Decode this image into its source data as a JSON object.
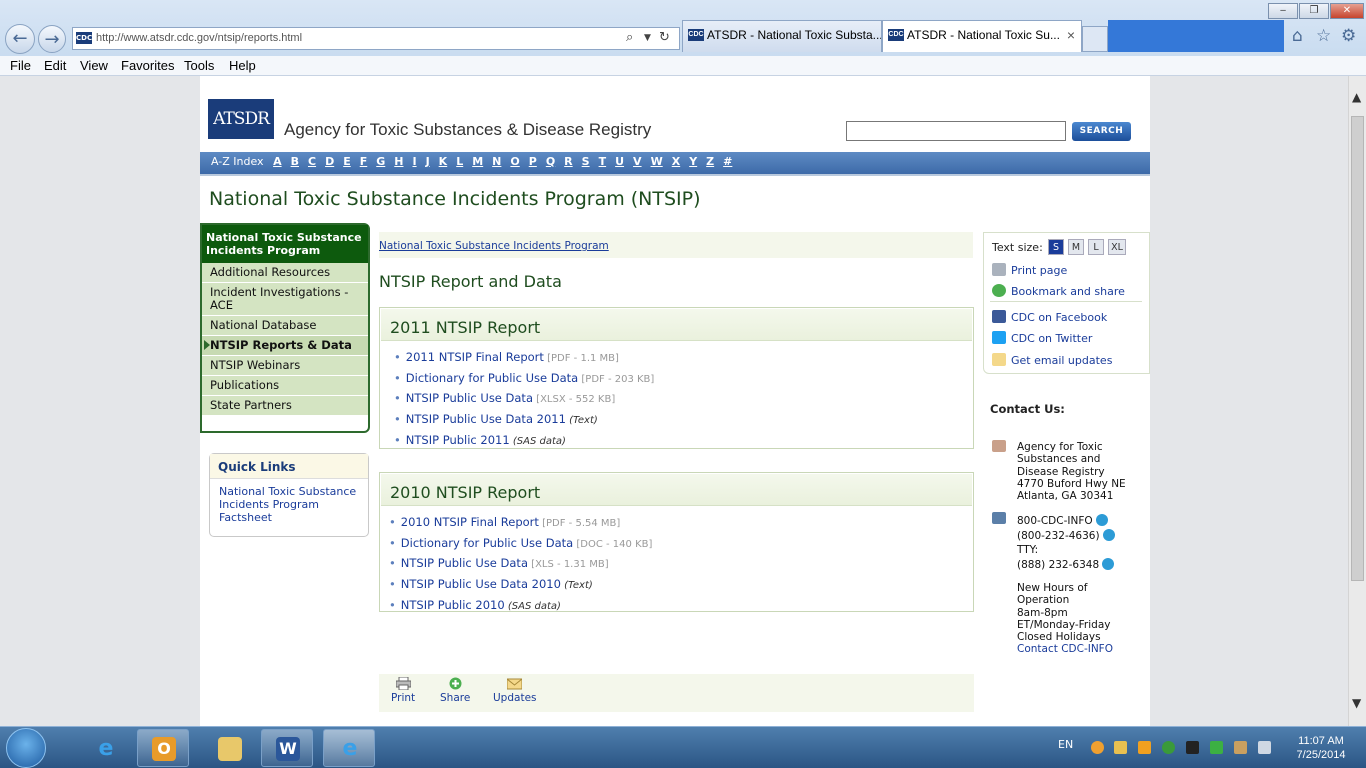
{
  "browser": {
    "url": "http://www.atsdr.cdc.gov/ntsip/reports.html",
    "favicon": "CDC",
    "tabs": [
      {
        "label": "ATSDR - National Toxic Substa...",
        "active": false
      },
      {
        "label": "ATSDR - National Toxic Su...",
        "active": true
      }
    ],
    "tab_close": "×",
    "menu": [
      "File",
      "Edit",
      "View",
      "Favorites",
      "Tools",
      "Help"
    ],
    "toolbar_icons": [
      "home-icon",
      "star-icon",
      "gear-icon"
    ]
  },
  "header": {
    "logo": "ATSDR",
    "agency": "Agency for Toxic Substances & Disease Registry",
    "search_button": "SEARCH",
    "search_value": ""
  },
  "az": {
    "label": "A-Z Index",
    "letters": [
      "A",
      "B",
      "C",
      "D",
      "E",
      "F",
      "G",
      "H",
      "I",
      "J",
      "K",
      "L",
      "M",
      "N",
      "O",
      "P",
      "Q",
      "R",
      "S",
      "T",
      "U",
      "V",
      "W",
      "X",
      "Y",
      "Z",
      "#"
    ]
  },
  "page_title": "National Toxic Substance Incidents Program (NTSIP)",
  "left_nav": {
    "header": "National Toxic Substance Incidents Program",
    "items": [
      "Additional Resources",
      "Incident Investigations - ACE",
      "National Database",
      "NTSIP Reports & Data",
      "NTSIP Webinars",
      "Publications",
      "State Partners"
    ],
    "active_index": 3
  },
  "quick_links": {
    "title": "Quick Links",
    "link": "National Toxic Substance Incidents Program Factsheet"
  },
  "breadcrumb": "National Toxic Substance Incidents Program",
  "heading": "NTSIP Report and Data",
  "reports": [
    {
      "title": "2011 NTSIP Report",
      "items": [
        {
          "label": "2011 NTSIP Final Report",
          "meta": "[PDF - 1.1 MB]",
          "italic": ""
        },
        {
          "label": "Dictionary for Public Use Data",
          "meta": "[PDF - 203 KB]",
          "italic": ""
        },
        {
          "label": "NTSIP Public Use Data",
          "meta": "[XLSX - 552 KB]",
          "italic": ""
        },
        {
          "label": "NTSIP Public Use Data 2011",
          "meta": "",
          "italic": "(Text)"
        },
        {
          "label": "NTSIP Public 2011",
          "meta": "",
          "italic": "(SAS data)"
        }
      ]
    },
    {
      "title": "2010 NTSIP Report",
      "items": [
        {
          "label": "2010 NTSIP Final Report",
          "meta": "[PDF - 5.54 MB]",
          "italic": ""
        },
        {
          "label": "Dictionary for Public Use Data",
          "meta": "[DOC - 140 KB]",
          "italic": ""
        },
        {
          "label": "NTSIP Public Use Data",
          "meta": "[XLS - 1.31 MB]",
          "italic": ""
        },
        {
          "label": "NTSIP Public Use Data 2010",
          "meta": "",
          "italic": "(Text)"
        },
        {
          "label": "NTSIP Public 2010",
          "meta": "",
          "italic": "(SAS data)"
        }
      ]
    }
  ],
  "footer_tools": {
    "print": "Print",
    "share": "Share",
    "updates": "Updates"
  },
  "right": {
    "text_size_label": "Text size:",
    "sizes": [
      "S",
      "M",
      "L",
      "XL"
    ],
    "links": [
      {
        "label": "Print page",
        "icon": "printer-icon"
      },
      {
        "label": "Bookmark and share",
        "icon": "plus-circle-icon"
      },
      {
        "label": "CDC on Facebook",
        "icon": "facebook-icon"
      },
      {
        "label": "CDC on Twitter",
        "icon": "twitter-icon"
      },
      {
        "label": "Get email updates",
        "icon": "email-icon"
      }
    ],
    "contact_title": "Contact Us:",
    "address": [
      "Agency for Toxic",
      "Substances and",
      "Disease Registry",
      "4770 Buford Hwy NE",
      "Atlanta, GA 30341"
    ],
    "phone1": "800-CDC-INFO",
    "phone2": "(800-232-4636)",
    "tty_label": "TTY:",
    "tty": "(888) 232-6348",
    "hours": [
      "New Hours of",
      "Operation",
      "8am-8pm",
      "ET/Monday-Friday",
      "Closed Holidays"
    ],
    "contact_link": "Contact CDC-INFO"
  },
  "taskbar": {
    "lang": "EN",
    "time": "11:07 AM",
    "date": "7/25/2014"
  },
  "colors": {
    "nav_green": "#0d5a0d",
    "link_blue": "#1a3c9a",
    "az_blue": "#3d6aa8"
  }
}
